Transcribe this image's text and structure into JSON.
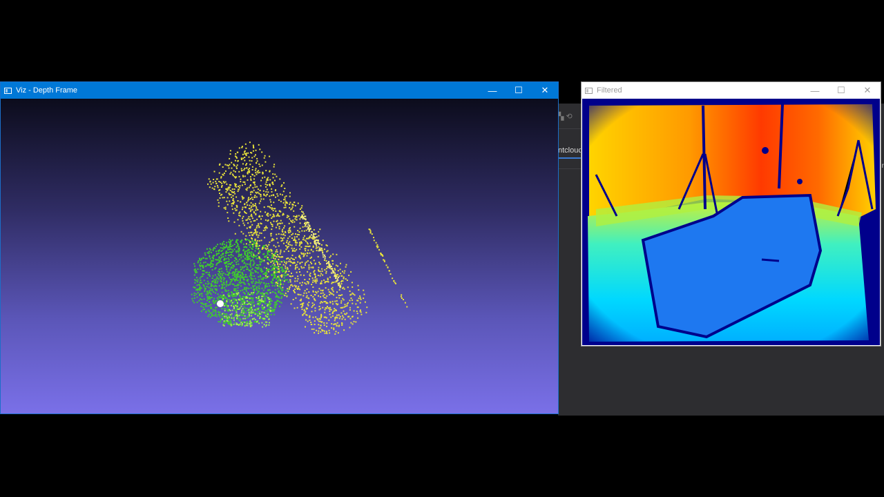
{
  "viz_window": {
    "title": "Viz - Depth Frame",
    "controls": {
      "minimize": "—",
      "maximize": "☐",
      "close": "✕"
    }
  },
  "filtered_window": {
    "title": "Filtered",
    "controls": {
      "minimize": "—",
      "maximize": "☐",
      "close": "✕"
    }
  },
  "background_app": {
    "tab_label": "ntclouc",
    "right_tab": "r"
  },
  "colors": {
    "titlebar_active": "#0078d7",
    "point_green": "#3fcf2a",
    "point_yellow": "#e8e23a"
  }
}
